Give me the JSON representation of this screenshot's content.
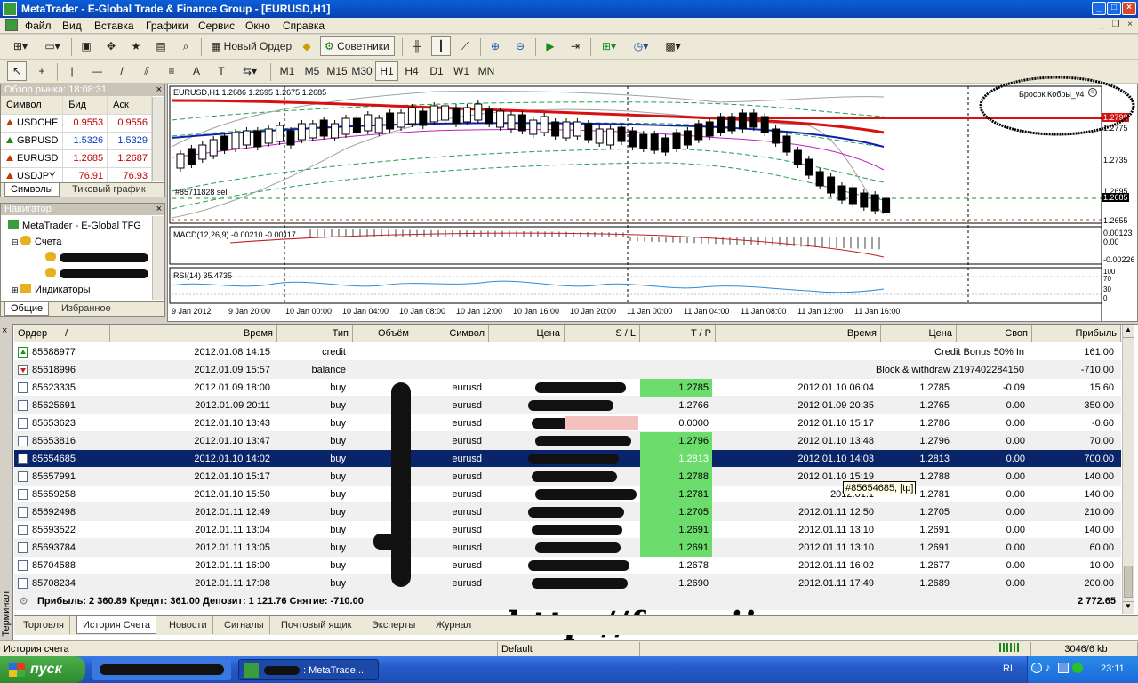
{
  "window": {
    "title": "MetaTrader - E-Global Trade & Finance Group - [EURUSD,H1]"
  },
  "menu": [
    "Файл",
    "Вид",
    "Вставка",
    "Графики",
    "Сервис",
    "Окно",
    "Справка"
  ],
  "toolbar": {
    "new_order": "Новый Ордер",
    "advisors": "Советники",
    "timeframes": [
      "M1",
      "M5",
      "M15",
      "M30",
      "H1",
      "H4",
      "D1",
      "W1",
      "MN"
    ],
    "active_timeframe": "H1"
  },
  "market_watch": {
    "title": "Обзор рынка: 18:08:31",
    "columns": [
      "Символ",
      "Бид",
      "Аск"
    ],
    "rows": [
      {
        "symbol": "USDCHF",
        "bid": "0.9553",
        "ask": "0.9556"
      },
      {
        "symbol": "GBPUSD",
        "bid": "1.5326",
        "ask": "1.5329"
      },
      {
        "symbol": "EURUSD",
        "bid": "1.2685",
        "ask": "1.2687"
      },
      {
        "symbol": "USDJPY",
        "bid": "76.91",
        "ask": "76.93"
      }
    ],
    "tabs": [
      "Символы",
      "Тиковый график"
    ]
  },
  "navigator": {
    "title": "Навигатор",
    "root": "MetaTrader - E-Global TFG",
    "accounts": "Счета",
    "indicators": "Индикаторы",
    "tabs": [
      "Общие",
      "Избранное"
    ]
  },
  "chart": {
    "header": "EURUSD,H1  1.2686 1.2695 1.2675 1.2685",
    "expert": "Бросок Кобры_v4",
    "order_label": "#85711828 sell",
    "macd_label": "MACD(12,26,9) -0.00210 -0.00117",
    "rsi_label": "RSI(14) 35.4735",
    "price_ticks": [
      "1.2775",
      "1.2735",
      "1.2695",
      "1.2685",
      "1.2655"
    ],
    "current_price": "1.2685",
    "red_line_label": "1.2790",
    "macd_ticks": [
      "0.00123",
      "0.00",
      "-0.00226"
    ],
    "rsi_ticks": [
      "100",
      "70",
      "30",
      "0"
    ],
    "time_ticks": [
      "9 Jan 2012",
      "9 Jan 20:00",
      "10 Jan 00:00",
      "10 Jan 04:00",
      "10 Jan 08:00",
      "10 Jan 12:00",
      "10 Jan 16:00",
      "10 Jan 20:00",
      "11 Jan 00:00",
      "11 Jan 04:00",
      "11 Jan 08:00",
      "11 Jan 12:00",
      "11 Jan 16:00"
    ],
    "colors": {
      "red_ma": "#d81010",
      "blue_ma": "#1020a8",
      "magenta": "#c020c0",
      "green_env": "#20a050"
    }
  },
  "terminal": {
    "side_label": "Терминал",
    "columns": [
      "Ордер",
      "Время",
      "Тип",
      "Объём",
      "Символ",
      "Цена",
      "S / L",
      "T / P",
      "Время",
      "Цена",
      "Своп",
      "Прибыль"
    ],
    "rows": [
      {
        "order": "85588977",
        "time": "2012.01.08 14:15",
        "type": "credit",
        "comment": "Credit Bonus 50% In",
        "profit": "161.00",
        "kind": "credit"
      },
      {
        "order": "85618996",
        "time": "2012.01.09 15:57",
        "type": "balance",
        "comment": "Block & withdraw Z197402284150",
        "profit": "-710.00",
        "kind": "balance"
      },
      {
        "order": "85623335",
        "time": "2012.01.09 18:00",
        "type": "buy",
        "symbol": "eurusd",
        "tp": "1.2785",
        "tp_hit": true,
        "close_time": "2012.01.10 06:04",
        "close_price": "1.2785",
        "swap": "-0.09",
        "profit": "15.60"
      },
      {
        "order": "85625691",
        "time": "2012.01.09 20:11",
        "type": "buy",
        "symbol": "eurusd",
        "tp": "1.2766",
        "tp_hit": false,
        "close_time": "2012.01.09 20:35",
        "close_price": "1.2765",
        "swap": "0.00",
        "profit": "350.00"
      },
      {
        "order": "85653623",
        "time": "2012.01.10 13:43",
        "type": "buy",
        "symbol": "eurusd",
        "tp": "0.0000",
        "tp_hit": false,
        "close_time": "2012.01.10 15:17",
        "close_price": "1.2786",
        "swap": "0.00",
        "profit": "-0.60"
      },
      {
        "order": "85653816",
        "time": "2012.01.10 13:47",
        "type": "buy",
        "symbol": "eurusd",
        "tp": "1.2796",
        "tp_hit": true,
        "close_time": "2012.01.10 13:48",
        "close_price": "1.2796",
        "swap": "0.00",
        "profit": "70.00"
      },
      {
        "order": "85654685",
        "time": "2012.01.10 14:02",
        "type": "buy",
        "symbol": "eurusd",
        "tp": "1.2813",
        "tp_hit": true,
        "close_time": "2012.01.10 14:03",
        "close_price": "1.2813",
        "swap": "0.00",
        "profit": "700.00",
        "selected": true
      },
      {
        "order": "85657991",
        "time": "2012.01.10 15:17",
        "type": "buy",
        "symbol": "eurusd",
        "tp": "1.2788",
        "tp_hit": true,
        "close_time": "2012.01.10 15:19",
        "close_price": "1.2788",
        "swap": "0.00",
        "profit": "140.00"
      },
      {
        "order": "85659258",
        "time": "2012.01.10 15:50",
        "type": "buy",
        "symbol": "eurusd",
        "tp": "1.2781",
        "tp_hit": true,
        "close_time": "2012.01.1",
        "close_price": "1.2781",
        "swap": "0.00",
        "profit": "140.00"
      },
      {
        "order": "85692498",
        "time": "2012.01.11 12:49",
        "type": "buy",
        "symbol": "eurusd",
        "tp": "1.2705",
        "tp_hit": true,
        "close_time": "2012.01.11 12:50",
        "close_price": "1.2705",
        "swap": "0.00",
        "profit": "210.00"
      },
      {
        "order": "85693522",
        "time": "2012.01.11 13:04",
        "type": "buy",
        "symbol": "eurusd",
        "tp": "1.2691",
        "tp_hit": true,
        "close_time": "2012.01.11 13:10",
        "close_price": "1.2691",
        "swap": "0.00",
        "profit": "140.00"
      },
      {
        "order": "85693784",
        "time": "2012.01.11 13:05",
        "type": "buy",
        "symbol": "eurusd",
        "tp": "1.2691",
        "tp_hit": true,
        "close_time": "2012.01.11 13:10",
        "close_price": "1.2691",
        "swap": "0.00",
        "profit": "60.00"
      },
      {
        "order": "85704588",
        "time": "2012.01.11 16:00",
        "type": "buy",
        "symbol": "eurusd",
        "tp": "1.2678",
        "tp_hit": false,
        "close_time": "2012.01.11 16:02",
        "close_price": "1.2677",
        "swap": "0.00",
        "profit": "10.00"
      },
      {
        "order": "85708234",
        "time": "2012.01.11 17:08",
        "type": "buy",
        "symbol": "eurusd",
        "tp": "1.2690",
        "tp_hit": false,
        "close_time": "2012.01.11 17:49",
        "close_price": "1.2689",
        "swap": "0.00",
        "profit": "200.00"
      }
    ],
    "tooltip": "#85654685, [tp]",
    "totals": "Прибыль: 2 360.89  Кредит: 361.00  Депозит: 1 121.76  Снятие: -710.00",
    "total_profit": "2 772.65",
    "tabs": [
      "Торговля",
      "История Счета",
      "Новости",
      "Сигналы",
      "Почтовый ящик",
      "Эксперты",
      "Журнал"
    ],
    "active_tab": "История Счета",
    "watermark": "http://forexii."
  },
  "status": {
    "left": "История счета",
    "profile": "Default",
    "traffic": "3046/6 kb"
  },
  "taskbar": {
    "start": "пуск",
    "task_label": ": MetaTrade...",
    "lang": "RL",
    "clock": "23:11"
  }
}
